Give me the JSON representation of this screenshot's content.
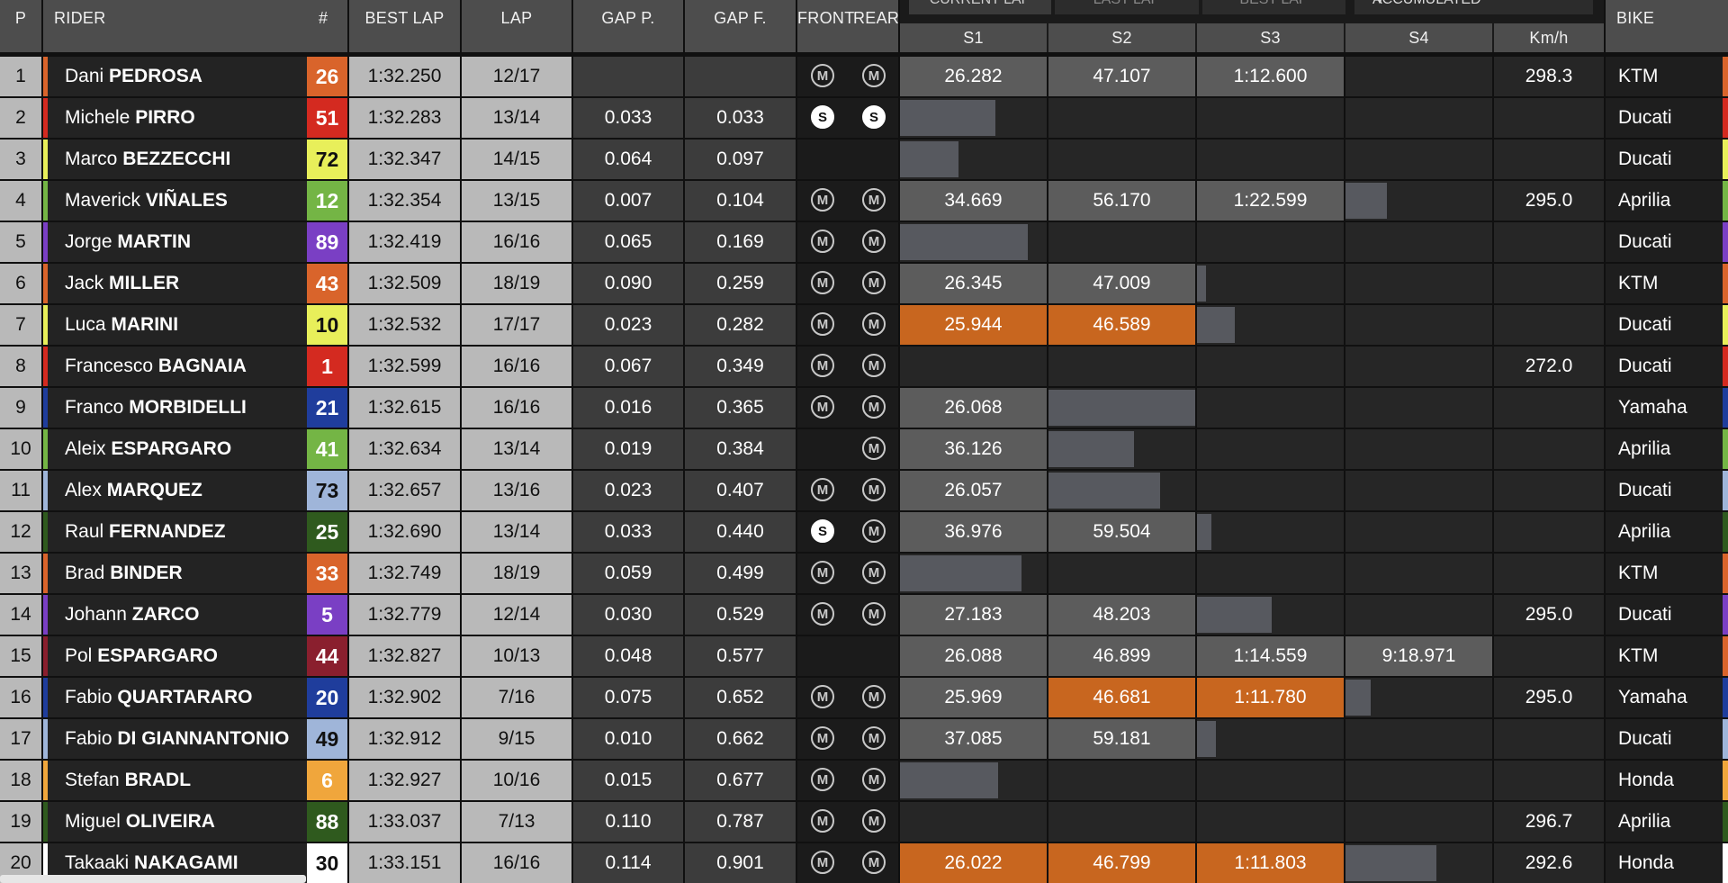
{
  "header": {
    "pos": "P",
    "rider": "RIDER",
    "number": "#",
    "best_lap": "BEST LAP",
    "lap": "LAP",
    "gap_p": "GAP P.",
    "gap_f": "GAP F.",
    "front": "FRONT",
    "rear": "REAR",
    "tabs": [
      "CURRENT LAP",
      "LAST LAP",
      "BEST LAP"
    ],
    "dropdown": "ACCUMULATED",
    "s1": "S1",
    "s2": "S2",
    "s3": "S3",
    "s4": "S4",
    "speed": "Km/h",
    "bike": "BIKE"
  },
  "colors": {
    "best_sector": "#c8661f",
    "sector_value": "#5c5c5c",
    "progress_bar": "#57595f"
  },
  "rows": [
    {
      "p": "1",
      "first": "Dani",
      "last": "PEDROSA",
      "num": "26",
      "num_bg": "#d9642b",
      "num_fg": "#ffffff",
      "team": "#d9642b",
      "best": "1:32.250",
      "lap": "12/17",
      "gapp": "",
      "gapf": "",
      "front": "M",
      "rear": "M",
      "s1": "26.282",
      "s2": "47.107",
      "s3": "1:12.600",
      "s4": "",
      "speed": "298.3",
      "bike": "KTM",
      "bikec": "#d9642b",
      "best_sectors": [],
      "bar_sector": null,
      "progress": 0
    },
    {
      "p": "2",
      "first": "Michele",
      "last": "PIRRO",
      "num": "51",
      "num_bg": "#d42a20",
      "num_fg": "#ffffff",
      "team": "#d42a20",
      "best": "1:32.283",
      "lap": "13/14",
      "gapp": "0.033",
      "gapf": "0.033",
      "front": "S",
      "rear": "S",
      "s1": "",
      "s2": "",
      "s3": "",
      "s4": "",
      "speed": "",
      "bike": "Ducati",
      "bikec": "#d42a20",
      "best_sectors": [],
      "bar_sector": "s1",
      "progress": 0.65
    },
    {
      "p": "3",
      "first": "Marco",
      "last": "BEZZECCHI",
      "num": "72",
      "num_bg": "#e8ef5a",
      "num_fg": "#111111",
      "team": "#e8ef5a",
      "best": "1:32.347",
      "lap": "14/15",
      "gapp": "0.064",
      "gapf": "0.097",
      "front": "",
      "rear": "",
      "s1": "",
      "s2": "",
      "s3": "",
      "s4": "",
      "speed": "",
      "bike": "Ducati",
      "bikec": "#e8ef5a",
      "best_sectors": [],
      "bar_sector": "s1",
      "progress": 0.4
    },
    {
      "p": "4",
      "first": "Maverick",
      "last": "VIÑALES",
      "num": "12",
      "num_bg": "#74b545",
      "num_fg": "#ffffff",
      "team": "#74b545",
      "best": "1:32.354",
      "lap": "13/15",
      "gapp": "0.007",
      "gapf": "0.104",
      "front": "M",
      "rear": "M",
      "s1": "34.669",
      "s2": "56.170",
      "s3": "1:22.599",
      "s4": "",
      "speed": "295.0",
      "bike": "Aprilia",
      "bikec": "#74b545",
      "best_sectors": [],
      "bar_sector": "s4",
      "progress": 0.28
    },
    {
      "p": "5",
      "first": "Jorge",
      "last": "MARTIN",
      "num": "89",
      "num_bg": "#7a3fc4",
      "num_fg": "#ffffff",
      "team": "#7a3fc4",
      "best": "1:32.419",
      "lap": "16/16",
      "gapp": "0.065",
      "gapf": "0.169",
      "front": "M",
      "rear": "M",
      "s1": "",
      "s2": "",
      "s3": "",
      "s4": "",
      "speed": "",
      "bike": "Ducati",
      "bikec": "#7a3fc4",
      "best_sectors": [],
      "bar_sector": "s1",
      "progress": 0.87
    },
    {
      "p": "6",
      "first": "Jack",
      "last": "MILLER",
      "num": "43",
      "num_bg": "#d9642b",
      "num_fg": "#ffffff",
      "team": "#d9642b",
      "best": "1:32.509",
      "lap": "18/19",
      "gapp": "0.090",
      "gapf": "0.259",
      "front": "M",
      "rear": "M",
      "s1": "26.345",
      "s2": "47.009",
      "s3": "",
      "s4": "",
      "speed": "",
      "bike": "KTM",
      "bikec": "#d9642b",
      "best_sectors": [],
      "bar_sector": "s3",
      "progress": 0.06
    },
    {
      "p": "7",
      "first": "Luca",
      "last": "MARINI",
      "num": "10",
      "num_bg": "#e8ef5a",
      "num_fg": "#111111",
      "team": "#e8ef5a",
      "best": "1:32.532",
      "lap": "17/17",
      "gapp": "0.023",
      "gapf": "0.282",
      "front": "M",
      "rear": "M",
      "s1": "25.944",
      "s2": "46.589",
      "s3": "",
      "s4": "",
      "speed": "",
      "bike": "Ducati",
      "bikec": "#e8ef5a",
      "best_sectors": [
        "s1",
        "s2"
      ],
      "bar_sector": "s3",
      "progress": 0.26
    },
    {
      "p": "8",
      "first": "Francesco",
      "last": "BAGNAIA",
      "num": "1",
      "num_bg": "#d42a20",
      "num_fg": "#ffffff",
      "team": "#d42a20",
      "best": "1:32.599",
      "lap": "16/16",
      "gapp": "0.067",
      "gapf": "0.349",
      "front": "M",
      "rear": "M",
      "s1": "",
      "s2": "",
      "s3": "",
      "s4": "",
      "speed": "272.0",
      "bike": "Ducati",
      "bikec": "#d42a20",
      "best_sectors": [],
      "bar_sector": null,
      "progress": 0
    },
    {
      "p": "9",
      "first": "Franco",
      "last": "MORBIDELLI",
      "num": "21",
      "num_bg": "#1f3d9c",
      "num_fg": "#ffffff",
      "team": "#1f3d9c",
      "best": "1:32.615",
      "lap": "16/16",
      "gapp": "0.016",
      "gapf": "0.365",
      "front": "M",
      "rear": "M",
      "s1": "26.068",
      "s2": "",
      "s3": "",
      "s4": "",
      "speed": "",
      "bike": "Yamaha",
      "bikec": "#1f3d9c",
      "best_sectors": [],
      "bar_sector": "s2",
      "progress": 1.0
    },
    {
      "p": "10",
      "first": "Aleix",
      "last": "ESPARGARO",
      "num": "41",
      "num_bg": "#74b545",
      "num_fg": "#ffffff",
      "team": "#74b545",
      "best": "1:32.634",
      "lap": "13/14",
      "gapp": "0.019",
      "gapf": "0.384",
      "front": "",
      "rear": "M",
      "s1": "36.126",
      "s2": "",
      "s3": "",
      "s4": "",
      "speed": "",
      "bike": "Aprilia",
      "bikec": "#74b545",
      "best_sectors": [],
      "bar_sector": "s2",
      "progress": 0.58
    },
    {
      "p": "11",
      "first": "Alex",
      "last": "MARQUEZ",
      "num": "73",
      "num_bg": "#9fb5d9",
      "num_fg": "#111111",
      "team": "#9fb5d9",
      "best": "1:32.657",
      "lap": "13/16",
      "gapp": "0.023",
      "gapf": "0.407",
      "front": "M",
      "rear": "M",
      "s1": "26.057",
      "s2": "",
      "s3": "",
      "s4": "",
      "speed": "",
      "bike": "Ducati",
      "bikec": "#9fb5d9",
      "best_sectors": [],
      "bar_sector": "s2",
      "progress": 0.76
    },
    {
      "p": "12",
      "first": "Raul",
      "last": "FERNANDEZ",
      "num": "25",
      "num_bg": "#2f5a1e",
      "num_fg": "#ffffff",
      "team": "#2f5a1e",
      "best": "1:32.690",
      "lap": "13/14",
      "gapp": "0.033",
      "gapf": "0.440",
      "front": "S",
      "rear": "M",
      "s1": "36.976",
      "s2": "59.504",
      "s3": "",
      "s4": "",
      "speed": "",
      "bike": "Aprilia",
      "bikec": "#2f5a1e",
      "best_sectors": [],
      "bar_sector": "s3",
      "progress": 0.1
    },
    {
      "p": "13",
      "first": "Brad",
      "last": "BINDER",
      "num": "33",
      "num_bg": "#d9642b",
      "num_fg": "#ffffff",
      "team": "#d9642b",
      "best": "1:32.749",
      "lap": "18/19",
      "gapp": "0.059",
      "gapf": "0.499",
      "front": "M",
      "rear": "M",
      "s1": "",
      "s2": "",
      "s3": "",
      "s4": "",
      "speed": "",
      "bike": "KTM",
      "bikec": "#d9642b",
      "best_sectors": [],
      "bar_sector": "s1",
      "progress": 0.83
    },
    {
      "p": "14",
      "first": "Johann",
      "last": "ZARCO",
      "num": "5",
      "num_bg": "#7a3fc4",
      "num_fg": "#ffffff",
      "team": "#7a3fc4",
      "best": "1:32.779",
      "lap": "12/14",
      "gapp": "0.030",
      "gapf": "0.529",
      "front": "M",
      "rear": "M",
      "s1": "27.183",
      "s2": "48.203",
      "s3": "",
      "s4": "",
      "speed": "295.0",
      "bike": "Ducati",
      "bikec": "#7a3fc4",
      "best_sectors": [],
      "bar_sector": "s3",
      "progress": 0.51
    },
    {
      "p": "15",
      "first": "Pol",
      "last": "ESPARGARO",
      "num": "44",
      "num_bg": "#8a1f2e",
      "num_fg": "#ffffff",
      "team": "#8a1f2e",
      "best": "1:32.827",
      "lap": "10/13",
      "gapp": "0.048",
      "gapf": "0.577",
      "front": "",
      "rear": "",
      "s1": "26.088",
      "s2": "46.899",
      "s3": "1:14.559",
      "s4": "9:18.971",
      "speed": "",
      "bike": "KTM",
      "bikec": "#d9642b",
      "best_sectors": [],
      "bar_sector": null,
      "progress": 0
    },
    {
      "p": "16",
      "first": "Fabio",
      "last": "QUARTARARO",
      "num": "20",
      "num_bg": "#1f3d9c",
      "num_fg": "#ffffff",
      "team": "#1f3d9c",
      "best": "1:32.902",
      "lap": "7/16",
      "gapp": "0.075",
      "gapf": "0.652",
      "front": "M",
      "rear": "M",
      "s1": "25.969",
      "s2": "46.681",
      "s3": "1:11.780",
      "s4": "",
      "speed": "295.0",
      "bike": "Yamaha",
      "bikec": "#1f3d9c",
      "best_sectors": [
        "s2",
        "s3"
      ],
      "bar_sector": "s4",
      "progress": 0.17
    },
    {
      "p": "17",
      "first": "Fabio",
      "last": "DI GIANNANTONIO",
      "num": "49",
      "num_bg": "#9fb5d9",
      "num_fg": "#111111",
      "team": "#9fb5d9",
      "best": "1:32.912",
      "lap": "9/15",
      "gapp": "0.010",
      "gapf": "0.662",
      "front": "M",
      "rear": "M",
      "s1": "37.085",
      "s2": "59.181",
      "s3": "",
      "s4": "",
      "speed": "",
      "bike": "Ducati",
      "bikec": "#9fb5d9",
      "best_sectors": [],
      "bar_sector": "s3",
      "progress": 0.13
    },
    {
      "p": "18",
      "first": "Stefan",
      "last": "BRADL",
      "num": "6",
      "num_bg": "#f0a63c",
      "num_fg": "#ffffff",
      "team": "#f0a63c",
      "best": "1:32.927",
      "lap": "10/16",
      "gapp": "0.015",
      "gapf": "0.677",
      "front": "M",
      "rear": "M",
      "s1": "",
      "s2": "",
      "s3": "",
      "s4": "",
      "speed": "",
      "bike": "Honda",
      "bikec": "#f0a63c",
      "best_sectors": [],
      "bar_sector": "s1",
      "progress": 0.67
    },
    {
      "p": "19",
      "first": "Miguel",
      "last": "OLIVEIRA",
      "num": "88",
      "num_bg": "#2f5a1e",
      "num_fg": "#ffffff",
      "team": "#2f5a1e",
      "best": "1:33.037",
      "lap": "7/13",
      "gapp": "0.110",
      "gapf": "0.787",
      "front": "M",
      "rear": "M",
      "s1": "",
      "s2": "",
      "s3": "",
      "s4": "",
      "speed": "296.7",
      "bike": "Aprilia",
      "bikec": "#2f5a1e",
      "best_sectors": [],
      "bar_sector": null,
      "progress": 0
    },
    {
      "p": "20",
      "first": "Takaaki",
      "last": "NAKAGAMI",
      "num": "30",
      "num_bg": "#ffffff",
      "num_fg": "#111111",
      "team": "#ffffff",
      "best": "1:33.151",
      "lap": "16/16",
      "gapp": "0.114",
      "gapf": "0.901",
      "front": "M",
      "rear": "M",
      "s1": "26.022",
      "s2": "46.799",
      "s3": "1:11.803",
      "s4": "",
      "speed": "292.6",
      "bike": "Honda",
      "bikec": "#ffffff",
      "best_sectors": [
        "s1",
        "s2",
        "s3"
      ],
      "bar_sector": "s4",
      "progress": 0.62
    }
  ]
}
